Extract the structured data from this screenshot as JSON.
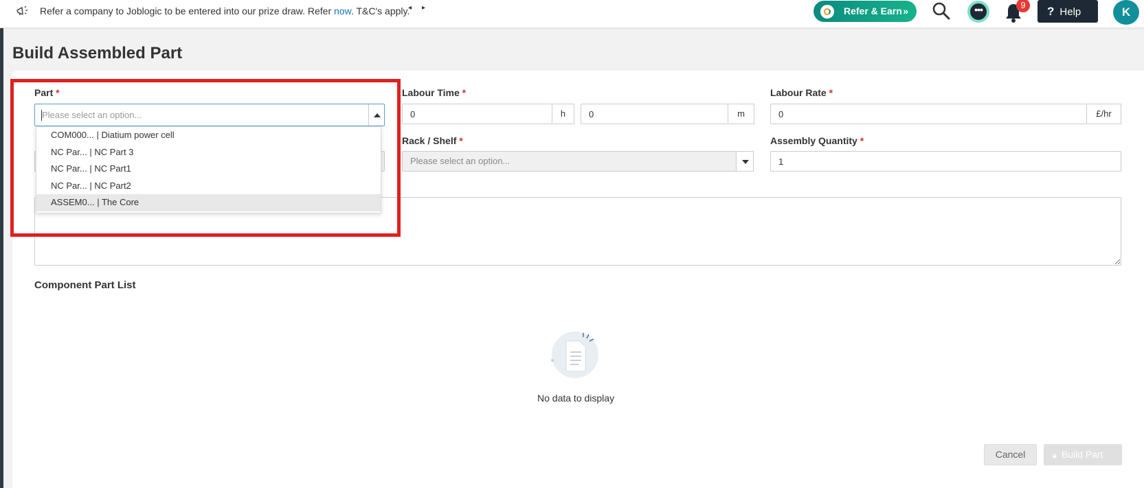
{
  "topbar": {
    "promo_text": "Refer a company to Joblogic to be entered into our prize draw. Refer ",
    "promo_link": "now",
    "promo_suffix": ". T&C's apply.",
    "refer_label": "Refer & Earn",
    "help_label": "Help",
    "notification_count": "9",
    "avatar_initial": "K",
    "icons": [
      "megaphone-icon",
      "prev-icon",
      "next-icon",
      "search-icon",
      "chat-icon",
      "bell-icon",
      "question-icon"
    ]
  },
  "page": {
    "title": "Build Assembled Part"
  },
  "form": {
    "part": {
      "label": "Part",
      "required_mark": "*",
      "placeholder": "Please select an option...",
      "options": [
        "COM000... | Diatium power cell",
        "NC Par... | NC Part 3",
        "NC Par... | NC Part1",
        "NC Par... | NC Part2",
        "ASSEM0... | The Core"
      ],
      "highlighted_option": "ASSEM0... | The Core"
    },
    "labour_time": {
      "label": "Labour Time",
      "required_mark": "*",
      "hours": "0",
      "hours_unit": "h",
      "minutes": "0",
      "minutes_unit": "m"
    },
    "labour_rate": {
      "label": "Labour Rate",
      "required_mark": "*",
      "value": "0",
      "unit": "£/hr"
    },
    "rack_shelf": {
      "label": "Rack / Shelf",
      "required_mark": "*",
      "placeholder": "Please select an option..."
    },
    "assembly_quantity": {
      "label": "Assembly Quantity",
      "required_mark": "*",
      "value": "1"
    }
  },
  "components": {
    "title": "Component Part List",
    "empty_text": "No data to display"
  },
  "actions": {
    "cancel_label": "Cancel",
    "build_label": "Build Part"
  },
  "colors": {
    "accent": "#0b8a7f",
    "highlight_box": "#e02020",
    "required": "#d32f2f",
    "dark": "#1d2a35"
  }
}
